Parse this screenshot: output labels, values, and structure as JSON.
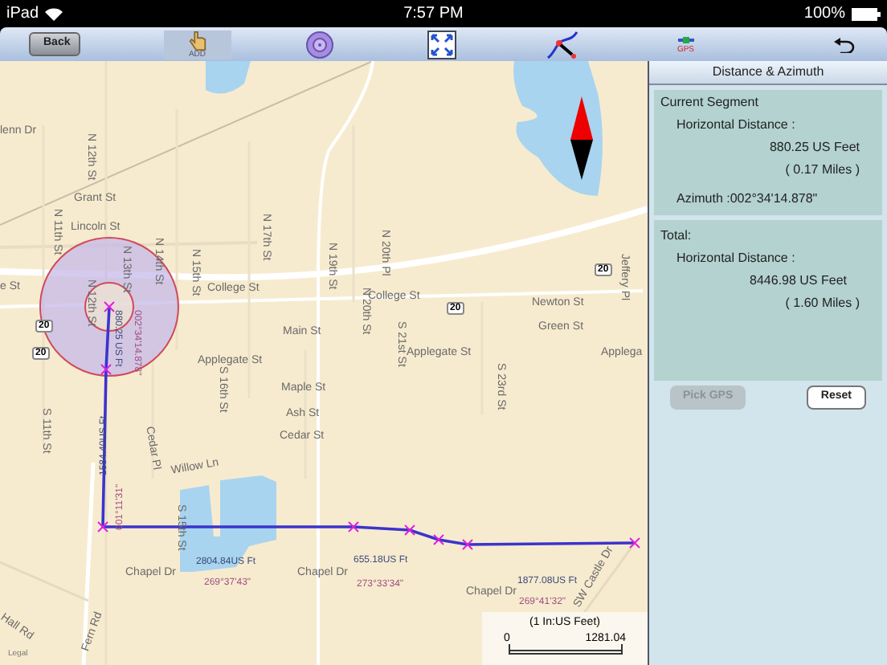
{
  "status_bar": {
    "device": "iPad",
    "time": "7:57 PM",
    "battery": "100%"
  },
  "toolbar": {
    "back": "Back",
    "tools": [
      {
        "kind": "add",
        "label": "ADD",
        "selected": true
      },
      {
        "kind": "target",
        "selected": false
      },
      {
        "kind": "fit",
        "selected": false
      },
      {
        "kind": "route",
        "selected": false
      },
      {
        "kind": "gps",
        "label": "GPS",
        "selected": false
      }
    ]
  },
  "map": {
    "street_labels": [
      "lenn Dr",
      "N 12th St",
      "Grant St",
      "N 11th St",
      "Lincoln St",
      "N 13th St",
      "N 14th St",
      "N 15th St",
      "N 17th St",
      "N 19th St",
      "N 20th Pl",
      "e St",
      "N 12th St",
      "College St",
      "N 20th St",
      "College St",
      "Newton St",
      "Green St",
      "Main St",
      "S 21st St",
      "Applegate St",
      "Applegate St",
      "Applega",
      "S 16th St",
      "S 23rd St",
      "Maple St",
      "Ash St",
      "Cedar St",
      "S 11th St",
      "Cedar Pl",
      "Willow Ln",
      "S 15th St",
      "Chapel Dr",
      "Chapel Dr",
      "Chapel Dr",
      "Hall Rd",
      "Fern Rd",
      "SW Castle Dr",
      "Jeffery Pl"
    ],
    "shields": [
      "20",
      "20",
      "20",
      "20"
    ],
    "route_labels": [
      {
        "distance": "880.25 US Ft",
        "azimuth": "002°34'14.878\""
      },
      {
        "distance": "1584.40US Ft",
        "azimuth": "001°11'31\""
      },
      {
        "distance": "2804.84US Ft",
        "azimuth": "269°37'43\""
      },
      {
        "distance": "655.18US Ft",
        "azimuth": "273°33'34\""
      },
      {
        "distance": "1877.08US Ft",
        "azimuth": "269°41'32\""
      }
    ],
    "legal": "Legal",
    "scale": {
      "title": "(1 In:US Feet)",
      "start": "0",
      "end": "1281.04"
    }
  },
  "panel": {
    "title": "Distance & Azimuth",
    "current": {
      "heading": "Current Segment",
      "label": "Horizontal Distance :",
      "feet": "880.25 US Feet",
      "miles": "( 0.17 Miles )",
      "azimuth": "Azimuth :002°34'14.878\""
    },
    "total": {
      "heading": "Total:",
      "label": "Horizontal Distance :",
      "feet": "8446.98 US Feet",
      "miles": "( 1.60 Miles )"
    },
    "buttons": [
      {
        "label": "Pick GPS",
        "disabled": true
      },
      {
        "label": "Reset",
        "disabled": false
      }
    ]
  }
}
